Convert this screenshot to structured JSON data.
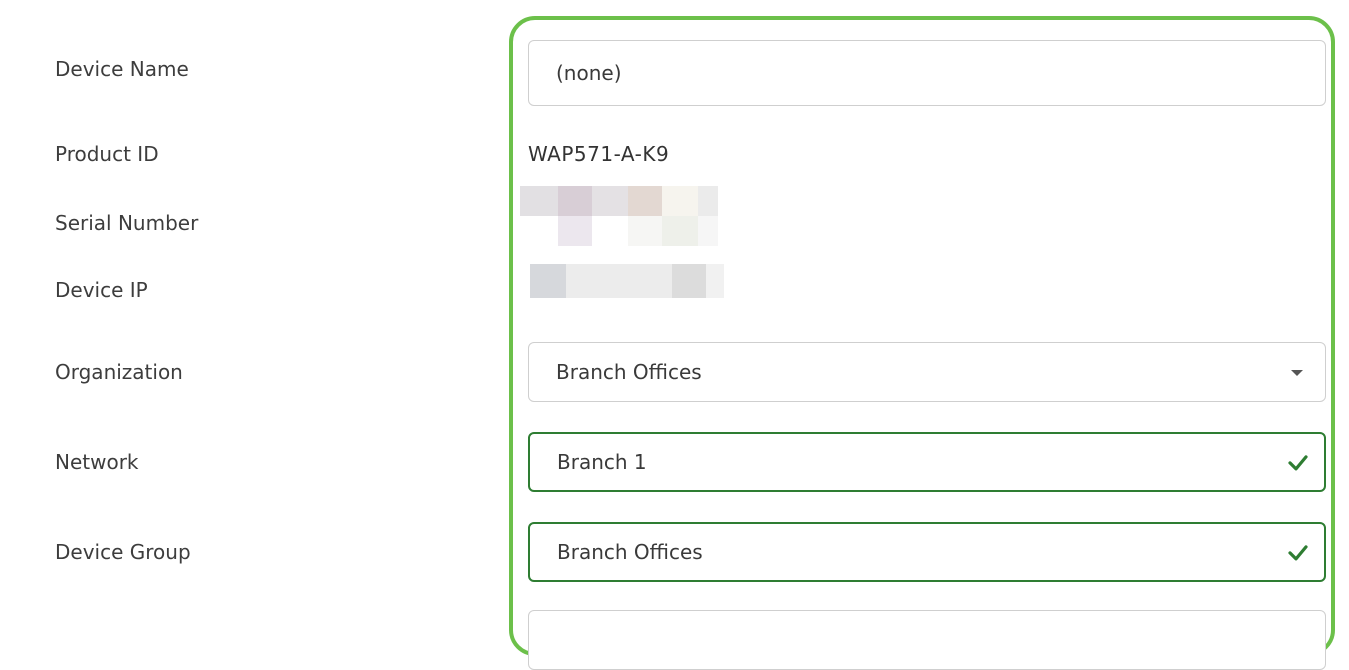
{
  "form": {
    "device_name": {
      "label": "Device Name",
      "value": "(none)"
    },
    "product_id": {
      "label": "Product ID",
      "value": "WAP571-A-K9"
    },
    "serial_number": {
      "label": "Serial Number"
    },
    "device_ip": {
      "label": "Device IP"
    },
    "organization": {
      "label": "Organization",
      "value": "Branch Offices",
      "icon": "caret-down-icon"
    },
    "network": {
      "label": "Network",
      "value": "Branch 1",
      "icon": "check-icon"
    },
    "device_group": {
      "label": "Device Group",
      "value": "Branch Offices",
      "icon": "check-icon"
    }
  },
  "colors": {
    "highlight_border": "#6cc04a",
    "valid_border": "#2e7d32",
    "check": "#2e7d32"
  }
}
